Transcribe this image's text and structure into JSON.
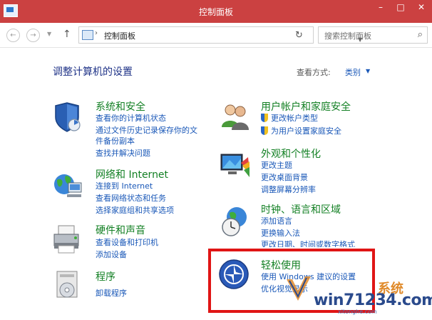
{
  "window": {
    "title": "控制面板",
    "min": "–",
    "max": "□",
    "close": "✕"
  },
  "address": {
    "path": "控制面板",
    "search_placeholder": "搜索控制面板"
  },
  "header": {
    "heading": "调整计算机的设置",
    "view_by_label": "查看方式:",
    "view_by_value": "类别"
  },
  "categories": {
    "system": {
      "title": "系统和安全",
      "links": [
        "查看你的计算机状态",
        "通过文件历史记录保存你的文",
        "件备份副本",
        "查找并解决问题"
      ]
    },
    "user": {
      "title": "用户帐户和家庭安全",
      "links": [
        "更改帐户类型",
        "为用户设置家庭安全"
      ]
    },
    "network": {
      "title": "网络和 Internet",
      "links": [
        "连接到 Internet",
        "查看网络状态和任务",
        "选择家庭组和共享选项"
      ]
    },
    "appearance": {
      "title": "外观和个性化",
      "links": [
        "更改主题",
        "更改桌面背景",
        "调整屏幕分辨率"
      ]
    },
    "hardware": {
      "title": "硬件和声音",
      "links": [
        "查看设备和打印机",
        "添加设备"
      ]
    },
    "clock": {
      "title": "时钟、语言和区域",
      "links": [
        "添加语言",
        "更换输入法",
        "更改日期、时间或数字格式"
      ]
    },
    "programs": {
      "title": "程序",
      "links": [
        "卸载程序"
      ]
    },
    "ease": {
      "title": "轻松使用",
      "links": [
        "使用 Windows 建议的设置",
        "优化视觉显示"
      ]
    }
  },
  "watermark": {
    "main": "win71234.com",
    "top": "系统",
    "sub": "xitonghe.com"
  },
  "colors": {
    "titlebar": "#cb4141",
    "category_title": "#138024",
    "link": "#1a58b8",
    "highlight": "#e01515"
  }
}
